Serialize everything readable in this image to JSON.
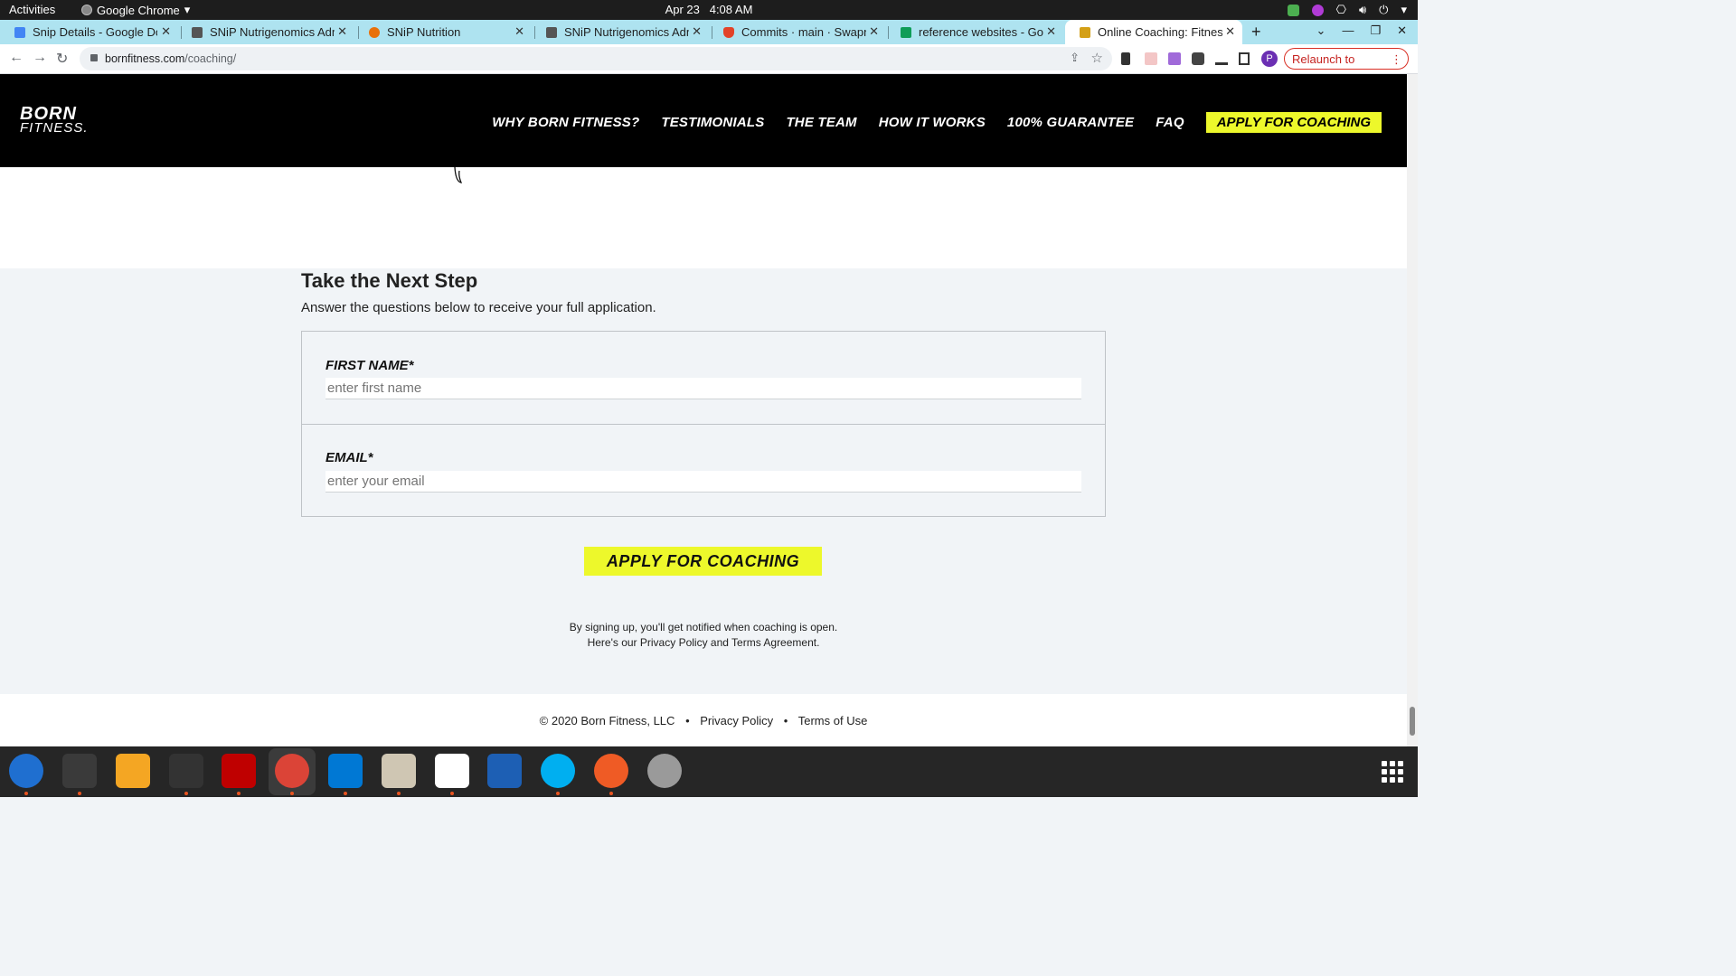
{
  "system_bar": {
    "activities": "Activities",
    "app_name": "Google Chrome",
    "date": "Apr 23",
    "time": "4:08 AM"
  },
  "tabs": [
    {
      "title": "Snip Details - Google Docs",
      "icon": "docs-icon",
      "color": "#4285f4"
    },
    {
      "title": "SNiP Nutrigenomics Admin",
      "icon": "snip-icon",
      "color": "#555555"
    },
    {
      "title": "SNiP Nutrition",
      "icon": "snip-nutrition-icon",
      "color": "#e8710a"
    },
    {
      "title": "SNiP Nutrigenomics Admin",
      "icon": "snip-icon",
      "color": "#555555"
    },
    {
      "title": "Commits · main · Swapnil",
      "icon": "gitlab-icon",
      "color": "#e24329"
    },
    {
      "title": "reference websites - Google Sheets",
      "icon": "sheets-icon",
      "color": "#0f9d58"
    },
    {
      "title": "Online Coaching: Fitness",
      "icon": "born-fitness-icon",
      "color": "#d4a017",
      "active": true
    }
  ],
  "browser": {
    "url_host": "bornfitness.com",
    "url_path": "/coaching/",
    "profile_initial": "P",
    "relaunch_label": "Relaunch to update"
  },
  "site": {
    "logo_line1": "BORN",
    "logo_line2": "FITNESS.",
    "nav": [
      "WHY BORN FITNESS?",
      "TESTIMONIALS",
      "THE TEAM",
      "HOW IT WORKS",
      "100% GUARANTEE",
      "FAQ"
    ],
    "nav_cta": "APPLY FOR COACHING",
    "accent": "#edf82b"
  },
  "form": {
    "title": "Take the Next Step",
    "subtitle": "Answer the questions below to receive your full application.",
    "first_name_label": "FIRST NAME*",
    "first_name_placeholder": "enter first name",
    "first_name_value": "",
    "email_label": "EMAIL*",
    "email_placeholder": "enter your email",
    "email_value": "",
    "submit_label": "APPLY FOR COACHING",
    "notice_line1": "By signing up, you'll get notified when coaching is open.",
    "notice_line2": "Here's our Privacy Policy and Terms Agreement."
  },
  "footer": {
    "copyright": "© 2020 Born Fitness, LLC",
    "privacy": "Privacy Policy",
    "terms": "Terms of Use"
  },
  "dock": [
    {
      "name": "thunderbird-icon",
      "color": "#1f6fd0",
      "running": true
    },
    {
      "name": "terminal-icon",
      "color": "#3a3a3a",
      "running": true
    },
    {
      "name": "calculator-icon",
      "color": "#f4a623",
      "running": false
    },
    {
      "name": "system-monitor-icon",
      "color": "#333333",
      "running": true
    },
    {
      "name": "filezilla-icon",
      "color": "#bf0000",
      "running": true
    },
    {
      "name": "chrome-icon",
      "color": "#db4437",
      "running": true
    },
    {
      "name": "vscode-icon",
      "color": "#0078d4",
      "running": true
    },
    {
      "name": "files-icon",
      "color": "#cfc6b3",
      "running": true
    },
    {
      "name": "text-editor-icon",
      "color": "#ffffff",
      "running": true
    },
    {
      "name": "document-viewer-icon",
      "color": "#1d5fb4",
      "running": false
    },
    {
      "name": "skype-icon",
      "color": "#00aff0",
      "running": true
    },
    {
      "name": "postman-icon",
      "color": "#ef5b25",
      "running": true
    },
    {
      "name": "disk-icon",
      "color": "#9a9a9a",
      "running": false
    }
  ]
}
